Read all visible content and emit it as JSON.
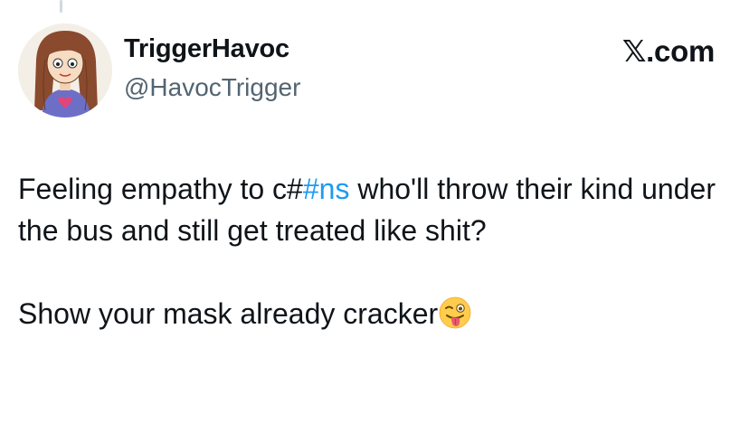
{
  "user": {
    "display_name": "TriggerHavoc",
    "handle": "@HavocTrigger"
  },
  "brand": {
    "label": "𝕏.com"
  },
  "tweet": {
    "line1_before": "Feeling empathy to c#",
    "hashtag": "#ns",
    "line1_after": " who'll throw their kind under the bus and still get treated like shit?",
    "line2": "Show your mask already cracker",
    "emoji_name": "winking-face-with-tongue-icon"
  },
  "colors": {
    "hashtag": "#1d9bf0",
    "handle": "#536471",
    "text": "#0f1419"
  }
}
